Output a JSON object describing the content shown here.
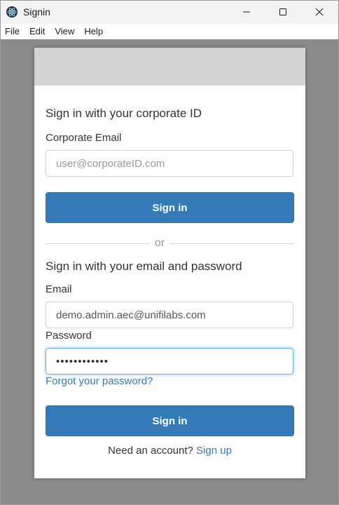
{
  "window": {
    "title": "Signin",
    "icon": "electron-atom-icon"
  },
  "menu": {
    "items": [
      "File",
      "Edit",
      "View",
      "Help"
    ]
  },
  "corporate": {
    "heading": "Sign in with your corporate ID",
    "email_label": "Corporate Email",
    "email_placeholder": "user@corporateID.com",
    "sign_in_label": "Sign in"
  },
  "divider_text": "or",
  "credentials": {
    "heading": "Sign in with your email and password",
    "email_label": "Email",
    "email_value": "demo.admin.aec@unifilabs.com",
    "password_label": "Password",
    "password_value": "••••••••••••",
    "forgot_label": "Forgot your password?",
    "sign_in_label": "Sign in"
  },
  "signup": {
    "prompt": "Need an account?",
    "link_label": "Sign up"
  },
  "colors": {
    "primary": "#337ab7",
    "link": "#337ab7",
    "backdrop": "#8b8b8b",
    "card_header": "#d3d3d3"
  }
}
